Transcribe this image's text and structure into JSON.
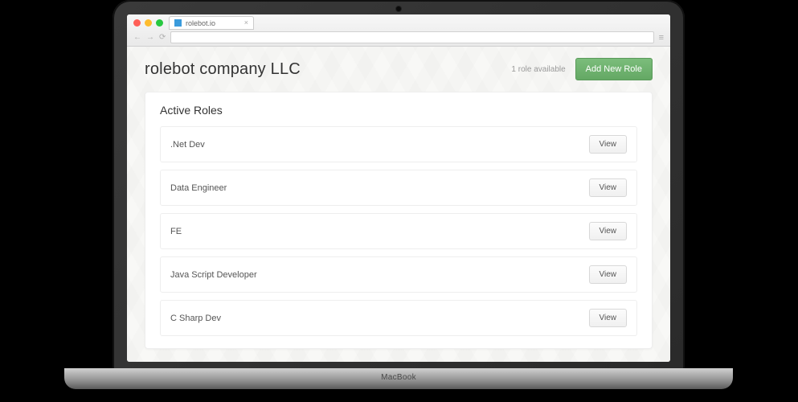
{
  "device": {
    "brand": "MacBook"
  },
  "browser": {
    "tab_title": "rolebot.io"
  },
  "header": {
    "company_name": "rolebot company LLC",
    "role_available": "1 role available",
    "add_role_label": "Add New Role"
  },
  "panel": {
    "title": "Active Roles",
    "view_label": "View",
    "roles": [
      {
        "name": ".Net Dev"
      },
      {
        "name": "Data Engineer"
      },
      {
        "name": "FE"
      },
      {
        "name": "Java Script Developer"
      },
      {
        "name": "C Sharp Dev"
      }
    ]
  }
}
